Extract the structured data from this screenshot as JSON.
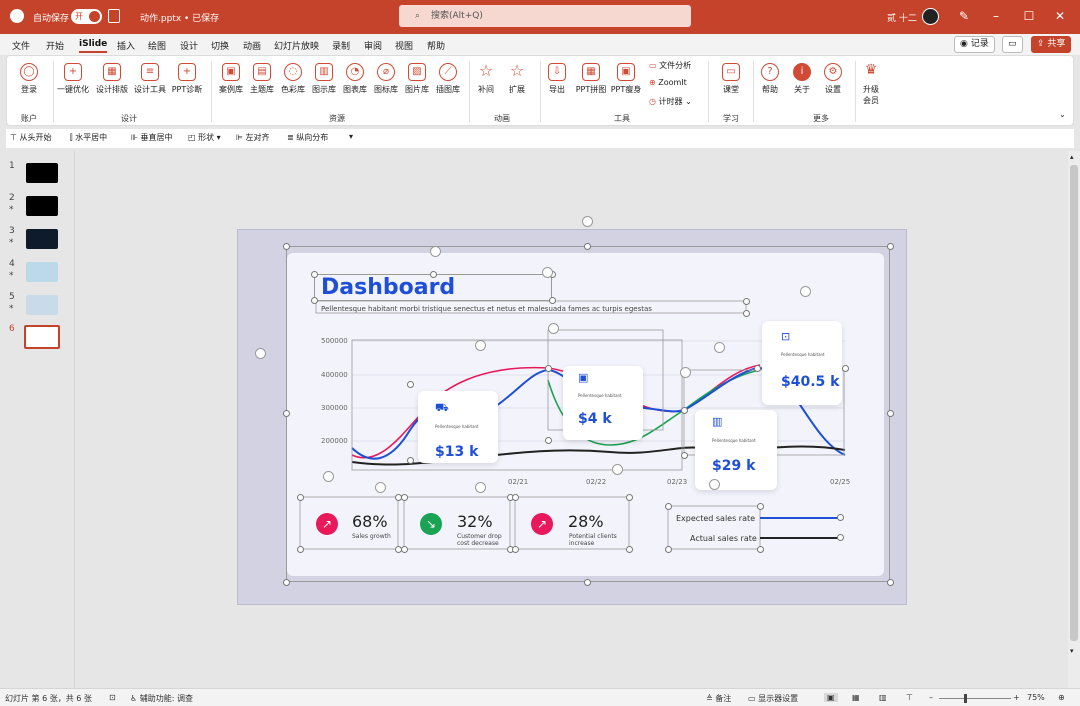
{
  "titlebar": {
    "autosave_label": "自动保存",
    "autosave_state": "开",
    "filename": "动作.pptx • 已保存",
    "search_placeholder": "搜索(Alt+Q)",
    "user_name": "贰 十二",
    "brand_color": "#c6432b"
  },
  "menu": {
    "tabs": [
      "文件",
      "开始",
      "iSlide",
      "插入",
      "绘图",
      "设计",
      "切换",
      "动画",
      "幻灯片放映",
      "录制",
      "审阅",
      "视图",
      "帮助"
    ],
    "active_tab": "iSlide",
    "record_label": "记录",
    "share_label": "共享"
  },
  "ribbon": {
    "account": {
      "btn": "登录",
      "group": "账户"
    },
    "design": {
      "btns": [
        "一键优化",
        "设计排版",
        "设计工具",
        "PPT诊断"
      ],
      "group": "设计"
    },
    "resources": {
      "btns": [
        "案例库",
        "主题库",
        "色彩库",
        "图示库",
        "图表库",
        "图标库",
        "图片库",
        "插图库"
      ],
      "group": "资源"
    },
    "animation": {
      "btns": [
        "补间",
        "扩展"
      ],
      "group": "动画"
    },
    "tools": {
      "btns": [
        "导出",
        "PPT拼图",
        "PPT瘦身"
      ],
      "side": [
        "文件分析",
        "ZoomIt",
        "计时器"
      ],
      "group": "工具"
    },
    "learn": {
      "btn": "课堂",
      "group": "学习"
    },
    "more": {
      "btns": [
        "帮助",
        "关于",
        "设置"
      ],
      "group": "更多"
    },
    "upgrade": {
      "label1": "升级",
      "label2": "会员"
    }
  },
  "qat": [
    "从头开始",
    "水平居中",
    "垂直居中",
    "形状",
    "左对齐",
    "纵向分布"
  ],
  "slides": [
    {
      "num": "1",
      "star": ""
    },
    {
      "num": "2",
      "star": "*"
    },
    {
      "num": "3",
      "star": "*"
    },
    {
      "num": "4",
      "star": "*"
    },
    {
      "num": "5",
      "star": "*"
    },
    {
      "num": "6",
      "star": ""
    }
  ],
  "dashboard": {
    "title": "Dashboard",
    "subtitle": "Pellentesque habitant morbi tristique senectus et netus et malesuada fames ac turpis egestas",
    "cards": [
      {
        "value": "$13 k",
        "small": "Pellentesque habitant"
      },
      {
        "value": "$4 k",
        "small": "Pellentesque habitant"
      },
      {
        "value": "$29 k",
        "small": "Pellentesque habitant"
      },
      {
        "value": "$40.5 k",
        "small": "Pellentesque habitant"
      }
    ],
    "kpis": [
      {
        "pct": "68%",
        "sub": "Sales growth",
        "color": "#e8185b"
      },
      {
        "pct": "32%",
        "sub": "Customer drop cost decrease",
        "color": "#1aa354"
      },
      {
        "pct": "28%",
        "sub": "Potential clients increase",
        "color": "#e8185b"
      }
    ],
    "legend": [
      "Expected sales rate",
      "Actual sales rate"
    ]
  },
  "chart_data": {
    "type": "line",
    "yticks": [
      "500000",
      "400000",
      "300000",
      "200000"
    ],
    "xticks": [
      "02/21",
      "02/22",
      "02/23",
      "02/25"
    ],
    "ylim": [
      150000,
      500000
    ],
    "series": [
      {
        "name": "Expected sales rate",
        "color": "#1e4fd6"
      },
      {
        "name": "Actual sales rate",
        "color": "#222222"
      }
    ],
    "extra_series_colors": [
      "#e8185b",
      "#1aa354"
    ]
  },
  "status": {
    "slide_info": "幻灯片 第 6 张，共 6 张",
    "accessibility": "辅助功能: 调查",
    "notes": "备注",
    "display": "显示器设置",
    "zoom": "75%"
  }
}
